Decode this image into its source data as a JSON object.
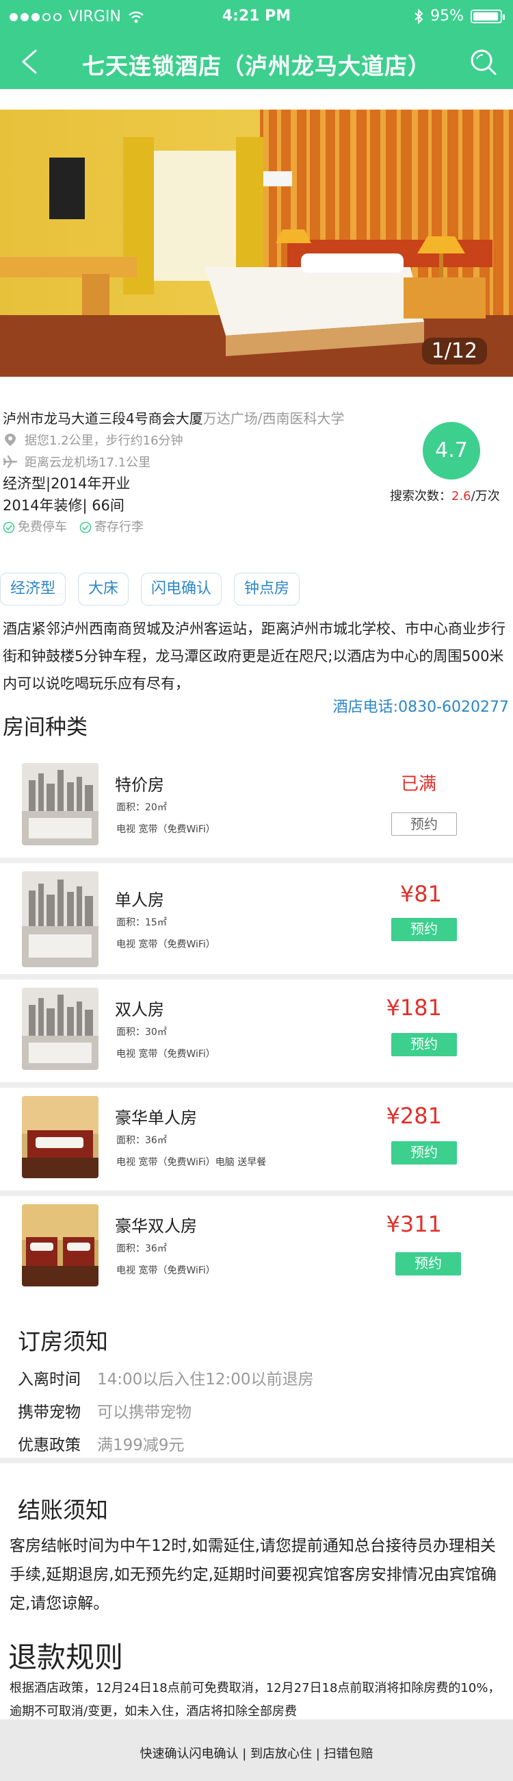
{
  "status_bar": {
    "carrier": "VIRGIN",
    "time": "4:21 PM",
    "battery": "95%"
  },
  "nav": {
    "title": "七天连锁酒店（泸州龙马大道店）"
  },
  "gallery": {
    "counter": "1/12"
  },
  "hotel": {
    "address_main": "泸州市龙马大道三段4号商会大厦",
    "address_sub": "万达广场/西南医科大学",
    "distance_walk": "据您1.2公里，步行约16分钟",
    "distance_airport": "距离云龙机场17.1公里",
    "category": "经济型|2014年开业",
    "renovation": "2014年装修| 66间",
    "feature_parking": "免费停车",
    "feature_luggage": "寄存行李",
    "score": "4.7",
    "search_label": "搜索次数：",
    "search_num": "2.6",
    "search_unit": "/万次"
  },
  "tags": [
    "经济型",
    "大床",
    "闪电确认",
    "钟点房"
  ],
  "description": "酒店紧邻泸州西南商贸城及泸州客运站，距离泸州市城北学校、市中心商业步行街和钟鼓楼5分钟车程，龙马潭区政府更是近在咫尺;以酒店为中心的周围500米内可以说吃喝玩乐应有尽有，",
  "phone": "酒店电话:0830-6020277",
  "rooms_title": "房间种类",
  "rooms": [
    {
      "name": "特价房",
      "area": "面积：20㎡",
      "amenities": "电视    宽带（免费WiFi）",
      "price": "",
      "status": "已满",
      "button": "预约"
    },
    {
      "name": "单人房",
      "area": "面积：15㎡",
      "amenities": "电视    宽带（免费WiFi）",
      "price": "¥81",
      "status": "",
      "button": "预约"
    },
    {
      "name": "双人房",
      "area": "面积：30㎡",
      "amenities": "电视    宽带（免费WiFi）",
      "price": "¥181",
      "status": "",
      "button": "预约"
    },
    {
      "name": "豪华单人房",
      "area": "面积：36㎡",
      "amenities": "电视    宽带（免费WiFi）电脑    送早餐",
      "price": "¥281",
      "status": "",
      "button": "预约"
    },
    {
      "name": "豪华双人房",
      "area": "面积：36㎡",
      "amenities": "电视    宽带（免费WiFi）",
      "price": "¥311",
      "status": "",
      "button": "预约"
    }
  ],
  "booking_notice": {
    "title": "订房须知",
    "checkin_label": "入离时间",
    "checkin_value": "14:00以后入住12:00以前退房",
    "pets_label": "携带宠物",
    "pets_value": "可以携带宠物",
    "promo_label": "优惠政策",
    "promo_value": "满199减9元"
  },
  "checkout_notice": {
    "title": "结账须知",
    "text": "客房结帐时间为中午12时,如需延住,请您提前通知总台接待员办理相关手续,延期退房,如无预先约定,延期时间要视宾馆客房安排情况由宾馆确定,请您谅解。"
  },
  "refund": {
    "title": "退款规则",
    "text": "根据酒店政策，12月24日18点前可免费取消，12月27日18点前取消将扣除房费的10%，逾期不可取消/变更，如未入住，酒店将扣除全部房费"
  },
  "footer": {
    "item1": "快速确认闪电确认",
    "item2": "到店放心住",
    "item3": "扫错包赔"
  },
  "colors": {
    "brand_green": "#3ccf8e",
    "price_red": "#e0302a",
    "link_blue": "#2c86c7"
  }
}
